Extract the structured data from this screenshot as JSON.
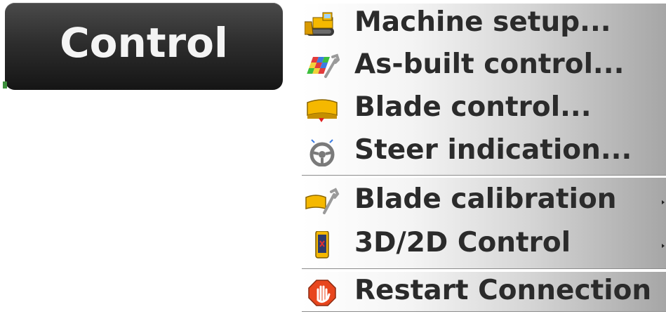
{
  "control_button": {
    "label": "Control"
  },
  "menu": {
    "group_main": [
      {
        "label": "Machine setup...",
        "icon": "bulldozer-icon"
      },
      {
        "label": "As-built control...",
        "icon": "asbuilt-wrench-icon"
      },
      {
        "label": "Blade control...",
        "icon": "blade-icon"
      },
      {
        "label": "Steer indication...",
        "icon": "steering-wheel-icon"
      }
    ],
    "group_submenus": [
      {
        "label": "Blade calibration",
        "icon": "blade-wrench-icon",
        "has_submenu": true
      },
      {
        "label": "3D/2D Control",
        "icon": "control-box-icon",
        "has_submenu": true
      }
    ],
    "group_restart": [
      {
        "label": "Restart Connection",
        "icon": "stop-hand-icon"
      }
    ]
  },
  "colors": {
    "button_bg": "#2e2e2e",
    "button_text": "#f4f4f4",
    "menu_text": "#2b2b2b",
    "accent_yellow": "#f5b800",
    "stop_red": "#e8461e"
  }
}
